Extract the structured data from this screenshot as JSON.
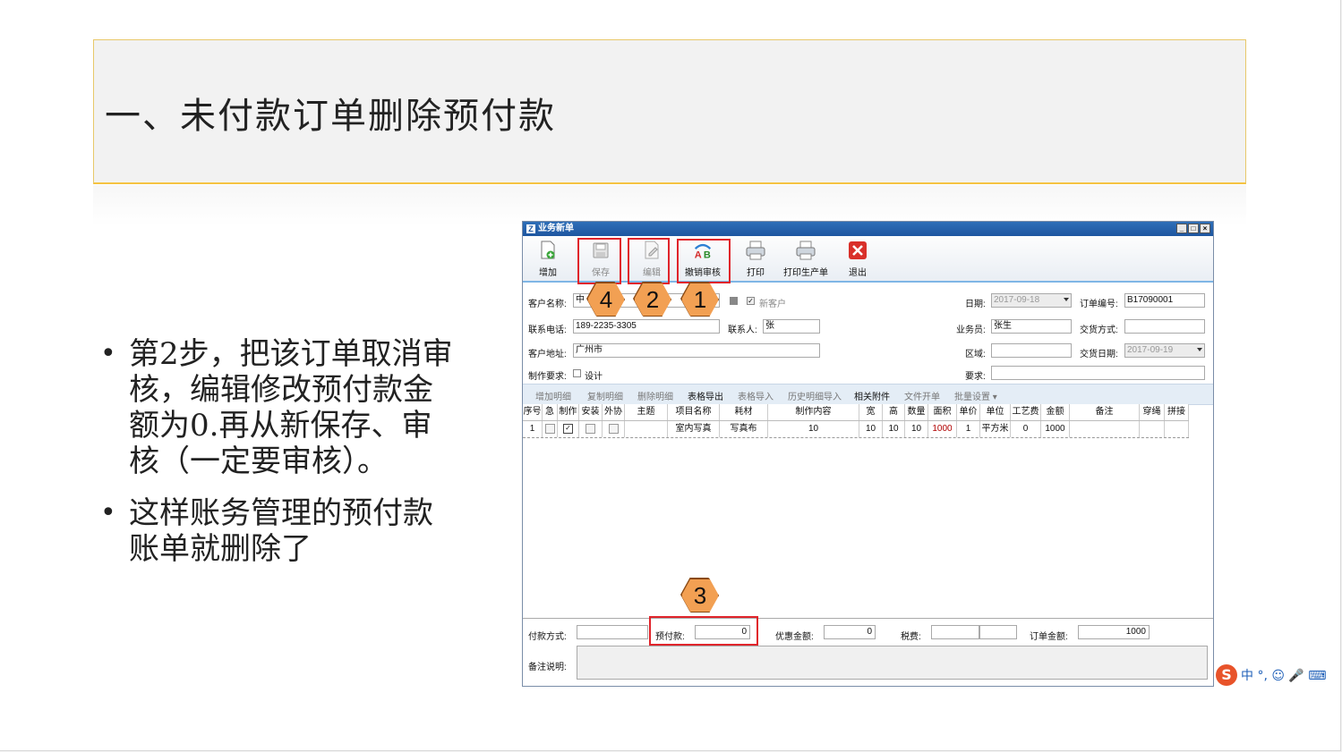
{
  "slide": {
    "title": "一、未付款订单删除预付款",
    "bullets": [
      "第2步，把该订单取消审核，编辑修改预付款金额为0.再从新保存、审核（一定要审核）。",
      "这样账务管理的预付款账单就删除了"
    ]
  },
  "window": {
    "title": "业务新单",
    "logo": "Z",
    "controls": [
      "_",
      "□",
      "×"
    ],
    "toolbar": [
      {
        "label": "增加",
        "icon": "add-doc-icon"
      },
      {
        "label": "保存",
        "icon": "save-icon"
      },
      {
        "label": "编辑",
        "icon": "edit-icon"
      },
      {
        "label": "撤销审核",
        "icon": "undo-audit-icon"
      },
      {
        "label": "打印",
        "icon": "printer-icon"
      },
      {
        "label": "打印生产单",
        "icon": "printer-icon"
      },
      {
        "label": "退出",
        "icon": "close-icon"
      }
    ],
    "badges": [
      "4",
      "2",
      "1",
      "3"
    ],
    "form": {
      "customer_name_label": "客户名称:",
      "customer_name_value": "中",
      "new_customer_label": "新客户",
      "date_label": "日期:",
      "date_value": "2017-09-18",
      "order_no_label": "订单编号:",
      "order_no_value": "B17090001",
      "phone_label": "联系电话:",
      "phone_value": "189-2235-3305",
      "contact_label": "联系人:",
      "contact_value": "张",
      "salesman_label": "业务员:",
      "salesman_value": "张生",
      "delivery_method_label": "交货方式:",
      "address_label": "客户地址:",
      "address_value": "广州市",
      "region_label": "区域:",
      "delivery_date_label": "交货日期:",
      "delivery_date_value": "2017-09-19",
      "production_req_label": "制作要求:",
      "design_label": "设计",
      "req_label": "要求:"
    },
    "subtoolbar": [
      {
        "label": "增加明细",
        "active": false
      },
      {
        "label": "复制明细",
        "active": false
      },
      {
        "label": "删除明细",
        "active": false
      },
      {
        "label": "表格导出",
        "active": true
      },
      {
        "label": "表格导入",
        "active": false
      },
      {
        "label": "历史明细导入",
        "active": false
      },
      {
        "label": "相关附件",
        "active": true
      },
      {
        "label": "文件开单",
        "active": false
      },
      {
        "label": "批量设置 ▾",
        "active": false
      }
    ],
    "grid": {
      "columns": [
        "序号",
        "急",
        "制作",
        "安装",
        "外协",
        "主题",
        "项目名称",
        "耗材",
        "制作内容",
        "宽",
        "高",
        "数量",
        "面积",
        "单价",
        "单位",
        "工艺费",
        "金额",
        "备注",
        "穿绳",
        "拼接"
      ],
      "row": {
        "seq": "1",
        "urgent": "",
        "make": "✓",
        "install": "",
        "outsource": "",
        "topic": "",
        "project": "室内写真",
        "material": "写真布",
        "content": "10",
        "width": "10",
        "height": "10",
        "qty": "10",
        "area": "1000",
        "price": "1",
        "unit": "平方米",
        "craft_fee": "0",
        "amount": "1000",
        "remark": "",
        "rope": "",
        "splice": ""
      }
    },
    "footer": {
      "payment_method_label": "付款方式:",
      "prepay_label": "预付款:",
      "prepay_value": "0",
      "discount_label": "优惠金额:",
      "discount_value": "0",
      "tax_label": "税费:",
      "order_amount_label": "订单金额:",
      "order_amount_value": "1000",
      "remark_label": "备注说明:"
    }
  },
  "ime": {
    "logo": "S",
    "text": "中 °, ☺ 🎤 ⌨"
  }
}
